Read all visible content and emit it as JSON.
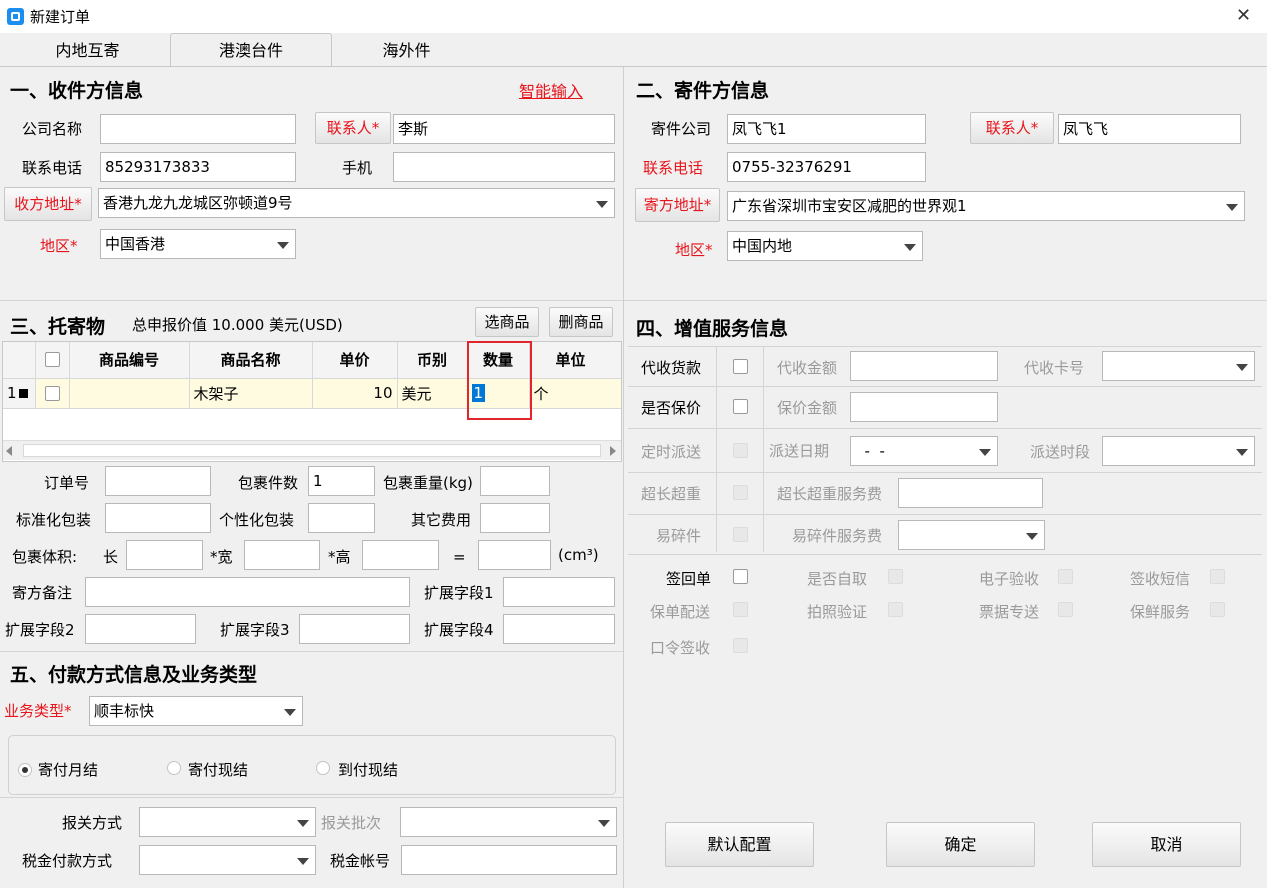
{
  "window": {
    "title": "新建订单",
    "close": "✕"
  },
  "tabs": [
    {
      "label": "内地互寄"
    },
    {
      "label": "港澳台件"
    },
    {
      "label": "海外件"
    }
  ],
  "recipient": {
    "title": "一、收件方信息",
    "smart_input": "智能输入",
    "company_label": "公司名称",
    "company_value": "",
    "contact_button": "联系人*",
    "contact_value": "李斯",
    "phone_label": "联系电话",
    "phone_value": "85293173833",
    "mobile_label": "手机",
    "mobile_value": "",
    "address_button": "收方地址*",
    "address_value": "香港九龙九龙城区弥顿道9号",
    "region_label": "地区*",
    "region_value": "中国香港"
  },
  "sender": {
    "title": "二、寄件方信息",
    "company_label": "寄件公司",
    "company_value": "凤飞飞1",
    "contact_button": "联系人*",
    "contact_value": "凤飞飞",
    "phone_label": "联系电话",
    "phone_value": "0755-32376291",
    "address_button": "寄方地址*",
    "address_value": "广东省深圳市宝安区减肥的世界观1",
    "region_label": "地区*",
    "region_value": "中国内地"
  },
  "goods": {
    "title": "三、托寄物",
    "declared_value": "总申报价值 10.000 美元(USD)",
    "select_button": "选商品",
    "delete_button": "删商品",
    "columns": [
      "商品编号",
      "商品名称",
      "单价",
      "币别",
      "数量",
      "单位"
    ],
    "rows": [
      {
        "index": "1",
        "code": "",
        "name": "木架子",
        "price": "10",
        "currency": "美元",
        "qty": "1",
        "unit": "个"
      }
    ]
  },
  "package": {
    "order_no_label": "订单号",
    "order_no_value": "",
    "count_label": "包裹件数",
    "count_value": "1",
    "weight_label": "包裹重量(kg)",
    "weight_value": "",
    "std_pack_label": "标准化包装",
    "std_pack_value": "",
    "custom_pack_label": "个性化包装",
    "custom_pack_value": "",
    "other_fee_label": "其它费用",
    "other_fee_value": "",
    "volume_label": "包裹体积:",
    "len_label": "长",
    "width_label": "*宽",
    "height_label": "*高",
    "eq_label": "=",
    "unit_label": "(cm³)",
    "remark_label": "寄方备注",
    "ext1_label": "扩展字段1",
    "ext2_label": "扩展字段2",
    "ext3_label": "扩展字段3",
    "ext4_label": "扩展字段4"
  },
  "payment": {
    "title": "五、付款方式信息及业务类型",
    "biz_type_label": "业务类型*",
    "biz_type_value": "顺丰标快",
    "options": [
      "寄付月结",
      "寄付现结",
      "到付现结"
    ],
    "selected": "寄付月结",
    "customs_label": "报关方式",
    "customs_value": "",
    "customs_batch_label": "报关批次",
    "customs_batch_value": "",
    "tax_pay_label": "税金付款方式",
    "tax_pay_value": "",
    "tax_account_label": "税金帐号",
    "tax_account_value": ""
  },
  "services": {
    "title": "四、增值服务信息",
    "cod_label": "代收货款",
    "cod_amount_label": "代收金额",
    "cod_card_label": "代收卡号",
    "insure_label": "是否保价",
    "insure_amount_label": "保价金额",
    "timed_label": "定时派送",
    "date_label": "派送日期",
    "date_value": "  -  -",
    "period_label": "派送时段",
    "oversize_label": "超长超重",
    "oversize_fee_label": "超长超重服务费",
    "fragile_label": "易碎件",
    "fragile_fee_label": "易碎件服务费",
    "options": [
      "签回单",
      "是否自取",
      "电子验收",
      "签收短信",
      "保单配送",
      "拍照验证",
      "票据专送",
      "保鲜服务",
      "口令签收"
    ]
  },
  "footer": {
    "default_button": "默认配置",
    "ok_button": "确定",
    "cancel_button": "取消"
  },
  "colors": {
    "required": "#e8141c",
    "accent_border": "#e0262a",
    "row_highlight": "#fffbe1",
    "selection": "#0078d7"
  }
}
